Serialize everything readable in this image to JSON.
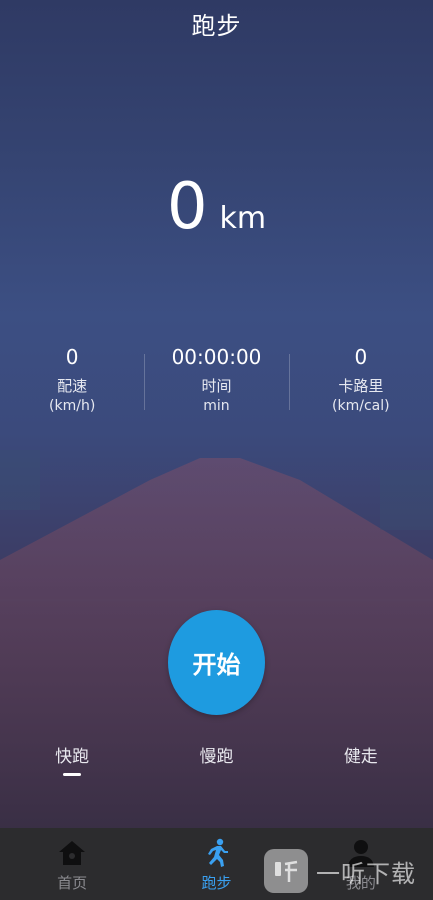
{
  "header": {
    "title": "跑步"
  },
  "distance": {
    "value": "0",
    "unit": "km"
  },
  "stats": [
    {
      "value": "0",
      "label": "配速",
      "unit": "(km/h)"
    },
    {
      "value": "00:00:00",
      "label": "时间",
      "unit": "min"
    },
    {
      "value": "0",
      "label": "卡路里",
      "unit": "(km/cal)"
    }
  ],
  "start_button": {
    "label": "开始",
    "color": "#1e9be0"
  },
  "modes": [
    {
      "label": "快跑",
      "active": true
    },
    {
      "label": "慢跑",
      "active": false
    },
    {
      "label": "健走",
      "active": false
    }
  ],
  "tabbar": {
    "items": [
      {
        "label": "首页",
        "icon": "home-icon",
        "active": false
      },
      {
        "label": "跑步",
        "icon": "runner-icon",
        "active": true
      },
      {
        "label": "我的",
        "icon": "person-icon",
        "active": false
      }
    ],
    "active_color": "#3aa0f0",
    "inactive_color": "#8b8b90"
  },
  "watermark": {
    "text": "一听下载"
  }
}
